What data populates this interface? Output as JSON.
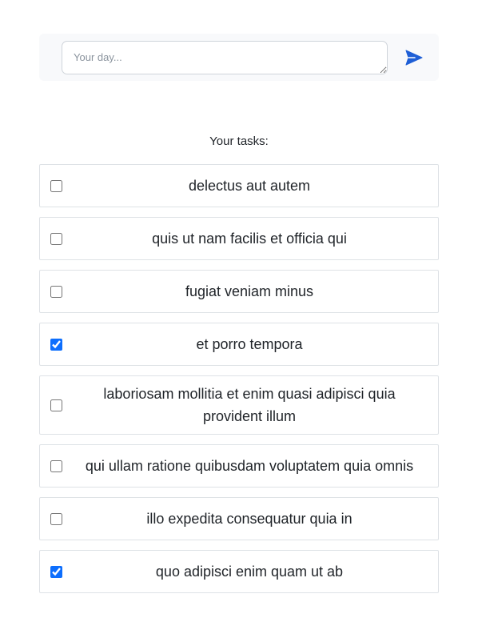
{
  "composer": {
    "placeholder": "Your day...",
    "value": "",
    "send_icon": "paper-plane-icon",
    "accent_color": "#1f5fd6"
  },
  "tasks_heading": "Your tasks:",
  "tasks": [
    {
      "text": "delectus aut autem",
      "completed": false
    },
    {
      "text": "quis ut nam facilis et officia qui",
      "completed": false
    },
    {
      "text": "fugiat veniam minus",
      "completed": false
    },
    {
      "text": "et porro tempora",
      "completed": true
    },
    {
      "text": "laboriosam mollitia et enim quasi adipisci quia provident illum",
      "completed": false
    },
    {
      "text": "qui ullam ratione quibusdam voluptatem quia omnis",
      "completed": false
    },
    {
      "text": "illo expedita consequatur quia in",
      "completed": false
    },
    {
      "text": "quo adipisci enim quam ut ab",
      "completed": true
    }
  ]
}
